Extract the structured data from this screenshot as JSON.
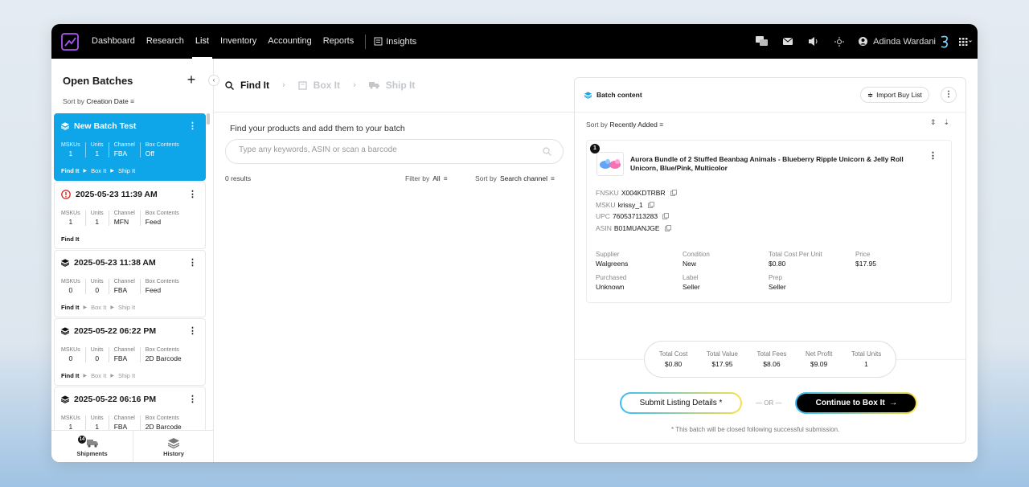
{
  "nav": {
    "links": [
      "Dashboard",
      "Research",
      "List",
      "Inventory",
      "Accounting",
      "Reports"
    ],
    "insights": "Insights",
    "user_name": "Adinda Wardani"
  },
  "sidebar": {
    "title": "Open Batches",
    "sort_label": "Sort by",
    "sort_value": "Creation Date",
    "stat_labels": {
      "mskus": "MSKUs",
      "units": "Units",
      "channel": "Channel",
      "box": "Box Contents"
    },
    "batches": [
      {
        "title": "New Batch Test",
        "mskus": "1",
        "units": "1",
        "channel": "FBA",
        "box": "Off",
        "steps": [
          "Find It",
          "Box It",
          "Ship It"
        ],
        "active": true,
        "icon": "layers-icon"
      },
      {
        "title": "2025-05-23 11:39 AM",
        "mskus": "1",
        "units": "1",
        "channel": "MFN",
        "box": "Feed",
        "steps": [
          "Find It"
        ],
        "active": false,
        "icon": "alert-icon"
      },
      {
        "title": "2025-05-23 11:38 AM",
        "mskus": "0",
        "units": "0",
        "channel": "FBA",
        "box": "Feed",
        "steps": [
          "Find It",
          "Box It",
          "Ship It"
        ],
        "active": false,
        "icon": "layers-icon"
      },
      {
        "title": "2025-05-22 06:22 PM",
        "mskus": "0",
        "units": "0",
        "channel": "FBA",
        "box": "2D Barcode",
        "steps": [
          "Find It",
          "Box It",
          "Ship It"
        ],
        "active": false,
        "icon": "layers-icon"
      },
      {
        "title": "2025-05-22 06:16 PM",
        "mskus": "1",
        "units": "1",
        "channel": "FBA",
        "box": "2D Barcode",
        "steps": [
          "Find It",
          "Box It",
          "Ship It"
        ],
        "active": false,
        "icon": "layers-icon"
      }
    ],
    "bottom_tabs": {
      "shipments": "Shipments",
      "shipments_badge": "14",
      "history": "History"
    }
  },
  "workflow": {
    "steps": [
      "Find It",
      "Box It",
      "Ship It"
    ],
    "hint": "Find your products and add them to your batch",
    "search_placeholder": "Type any keywords, ASIN or scan a barcode",
    "results": "0 results",
    "filter_label": "Filter by",
    "filter_value": "All",
    "sort_label": "Sort by",
    "sort_value": "Search channel"
  },
  "batch_content": {
    "title": "Batch content",
    "import_label": "Import Buy List",
    "sort_label": "Sort by",
    "sort_value": "Recently Added",
    "item": {
      "qty": "1",
      "title": "Aurora Bundle of 2 Stuffed Beanbag Animals - Blueberry Ripple Unicorn & Jelly Roll Unicorn, Blue/Pink, Multicolor",
      "ids": [
        {
          "k": "FNSKU",
          "v": "X004KDTRBR"
        },
        {
          "k": "MSKU",
          "v": "krissy_1"
        },
        {
          "k": "UPC",
          "v": "760537113283"
        },
        {
          "k": "ASIN",
          "v": "B01MUANJGE"
        }
      ],
      "supplier_label": "Supplier",
      "supplier": "Walgreens",
      "condition_label": "Condition",
      "condition": "New",
      "tcpu_label": "Total Cost Per Unit",
      "tcpu": "$0.80",
      "price_label": "Price",
      "price": "$17.95",
      "purchased_label": "Purchased",
      "purchased": "Unknown",
      "label_label": "Label",
      "label": "Seller",
      "prep_label": "Prep",
      "prep": "Seller"
    },
    "totals": [
      {
        "k": "Total Cost",
        "v": "$0.80"
      },
      {
        "k": "Total Value",
        "v": "$17.95"
      },
      {
        "k": "Total Fees",
        "v": "$8.06"
      },
      {
        "k": "Net Profit",
        "v": "$9.09"
      },
      {
        "k": "Total Units",
        "v": "1"
      }
    ],
    "submit_label": "Submit Listing Details *",
    "or_label": "— OR —",
    "continue_label": "Continue to Box It",
    "note": "* This batch will be closed following successful submission."
  },
  "colors": {
    "accent": "#0ea5e9",
    "nav_bg": "#000000",
    "logo": "#a855f7"
  }
}
